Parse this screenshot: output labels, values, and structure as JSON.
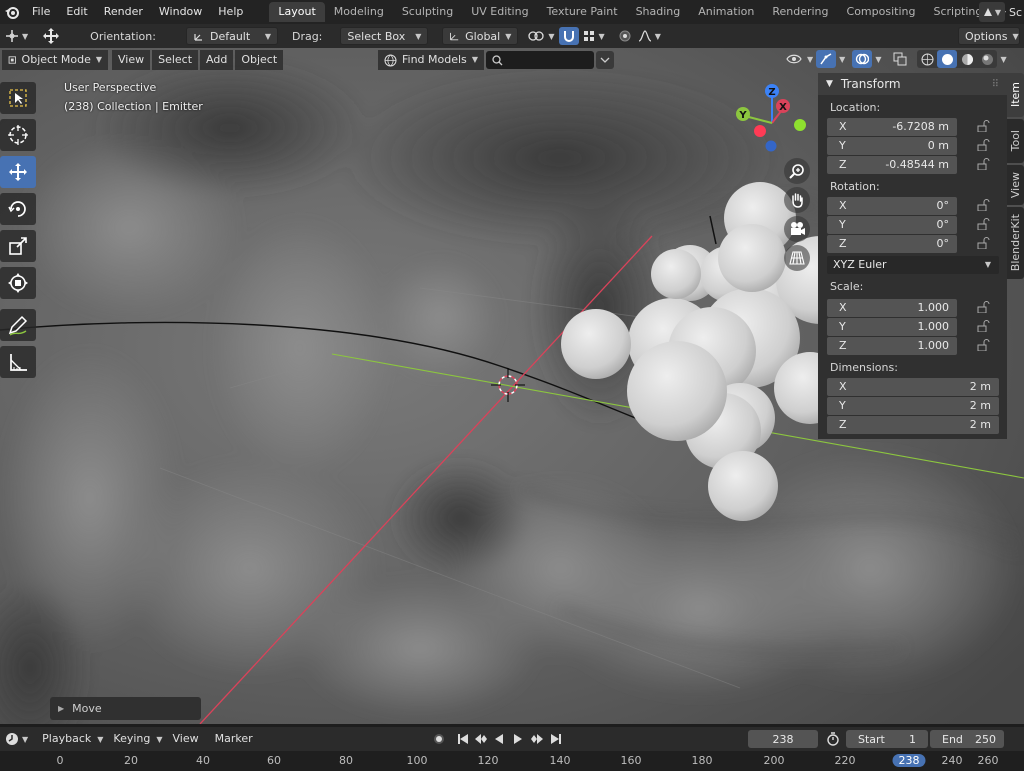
{
  "topbar": {
    "menus": [
      "File",
      "Edit",
      "Render",
      "Window",
      "Help"
    ],
    "workspaces": [
      "Layout",
      "Modeling",
      "Sculpting",
      "UV Editing",
      "Texture Paint",
      "Shading",
      "Animation",
      "Rendering",
      "Compositing",
      "Scripting"
    ],
    "active_workspace": "Layout",
    "add_tab": "+",
    "scene_label": "Sc"
  },
  "header": {
    "orientation_label": "Orientation:",
    "orientation_value": "Default",
    "drag_label": "Drag:",
    "drag_value": "Select Box",
    "transform_space": "Global",
    "options_label": "Options"
  },
  "viewport": {
    "mode": "Object Mode",
    "menus": [
      "View",
      "Select",
      "Add",
      "Object"
    ],
    "find_models": "Find Models",
    "perspective_text": "User Perspective",
    "collection_text": "(238) Collection | Emitter"
  },
  "gizmo": {
    "x": "X",
    "y": "Y",
    "z": "Z"
  },
  "transform_panel": {
    "title": "Transform",
    "location_label": "Location:",
    "location": [
      {
        "axis": "X",
        "value": "-6.7208 m"
      },
      {
        "axis": "Y",
        "value": "0 m"
      },
      {
        "axis": "Z",
        "value": "-0.48544 m"
      }
    ],
    "rotation_label": "Rotation:",
    "rotation": [
      {
        "axis": "X",
        "value": "0°"
      },
      {
        "axis": "Y",
        "value": "0°"
      },
      {
        "axis": "Z",
        "value": "0°"
      }
    ],
    "rotation_mode": "XYZ Euler",
    "scale_label": "Scale:",
    "scale": [
      {
        "axis": "X",
        "value": "1.000"
      },
      {
        "axis": "Y",
        "value": "1.000"
      },
      {
        "axis": "Z",
        "value": "1.000"
      }
    ],
    "dimensions_label": "Dimensions:",
    "dimensions": [
      {
        "axis": "X",
        "value": "2 m"
      },
      {
        "axis": "Y",
        "value": "2 m"
      },
      {
        "axis": "Z",
        "value": "2 m"
      }
    ]
  },
  "side_tabs": [
    "Item",
    "Tool",
    "View",
    "BlenderKit"
  ],
  "active_side_tab": "Item",
  "redo_panel": {
    "label": "Move"
  },
  "timeline": {
    "menus": [
      "Playback",
      "Keying",
      "View",
      "Marker"
    ],
    "current_frame": "238",
    "start_label": "Start",
    "start_value": "1",
    "end_label": "End",
    "end_value": "250"
  },
  "ruler": {
    "ticks": [
      "0",
      "20",
      "40",
      "60",
      "80",
      "100",
      "120",
      "140",
      "160",
      "180",
      "200",
      "220"
    ],
    "current": "238",
    "after": [
      "240",
      "260"
    ]
  },
  "colors": {
    "accent": "#4772b3",
    "x_axis": "#d9435a",
    "y_axis": "#8cc63f",
    "z_axis": "#3b82f6"
  }
}
